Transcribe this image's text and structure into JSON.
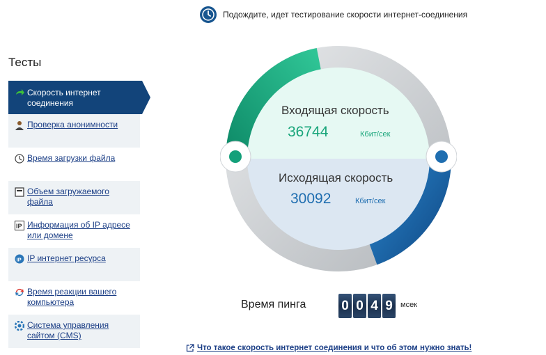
{
  "status": {
    "text": "Подождите, идет тестирование скорости интернет-соединения",
    "icon": "clock-icon"
  },
  "sidebar": {
    "title": "Тесты",
    "items": [
      {
        "label": "Скорость интернет соединения",
        "icon": "green-arrow-icon",
        "active": true
      },
      {
        "label": "Проверка анонимности",
        "icon": "anonymous-user-icon"
      },
      {
        "label": "Время загрузки файла",
        "icon": "clock-icon"
      },
      {
        "label": "Объем загружаемого файла",
        "icon": "file-icon"
      },
      {
        "label": "Информация об IP адресе или домене",
        "icon": "ip-icon"
      },
      {
        "label": "IP интернет ресурса",
        "icon": "ip-globe-icon"
      },
      {
        "label": "Время реакции вашего компьютера",
        "icon": "refresh-icon"
      },
      {
        "label": "Система управления сайтом (CMS)",
        "icon": "cms-icon"
      }
    ]
  },
  "gauge": {
    "download": {
      "label": "Входящая скорость",
      "value": "36744",
      "unit": "Кбит/сек",
      "color": "#18a57a"
    },
    "upload": {
      "label": "Исходящая скорость",
      "value": "30092",
      "unit": "Кбит/сек",
      "color": "#1f6eb0"
    }
  },
  "ping": {
    "label": "Время пинга",
    "digits": [
      "0",
      "0",
      "4",
      "9"
    ],
    "unit": "мсек"
  },
  "footer": {
    "link": "Что такое скорость интернет соединения и что об этом нужно знать!",
    "icon": "external-link-icon"
  },
  "colors": {
    "accent": "#12447a",
    "download": "#18a57a",
    "upload": "#1f6eb0",
    "link": "#1c3f86"
  }
}
